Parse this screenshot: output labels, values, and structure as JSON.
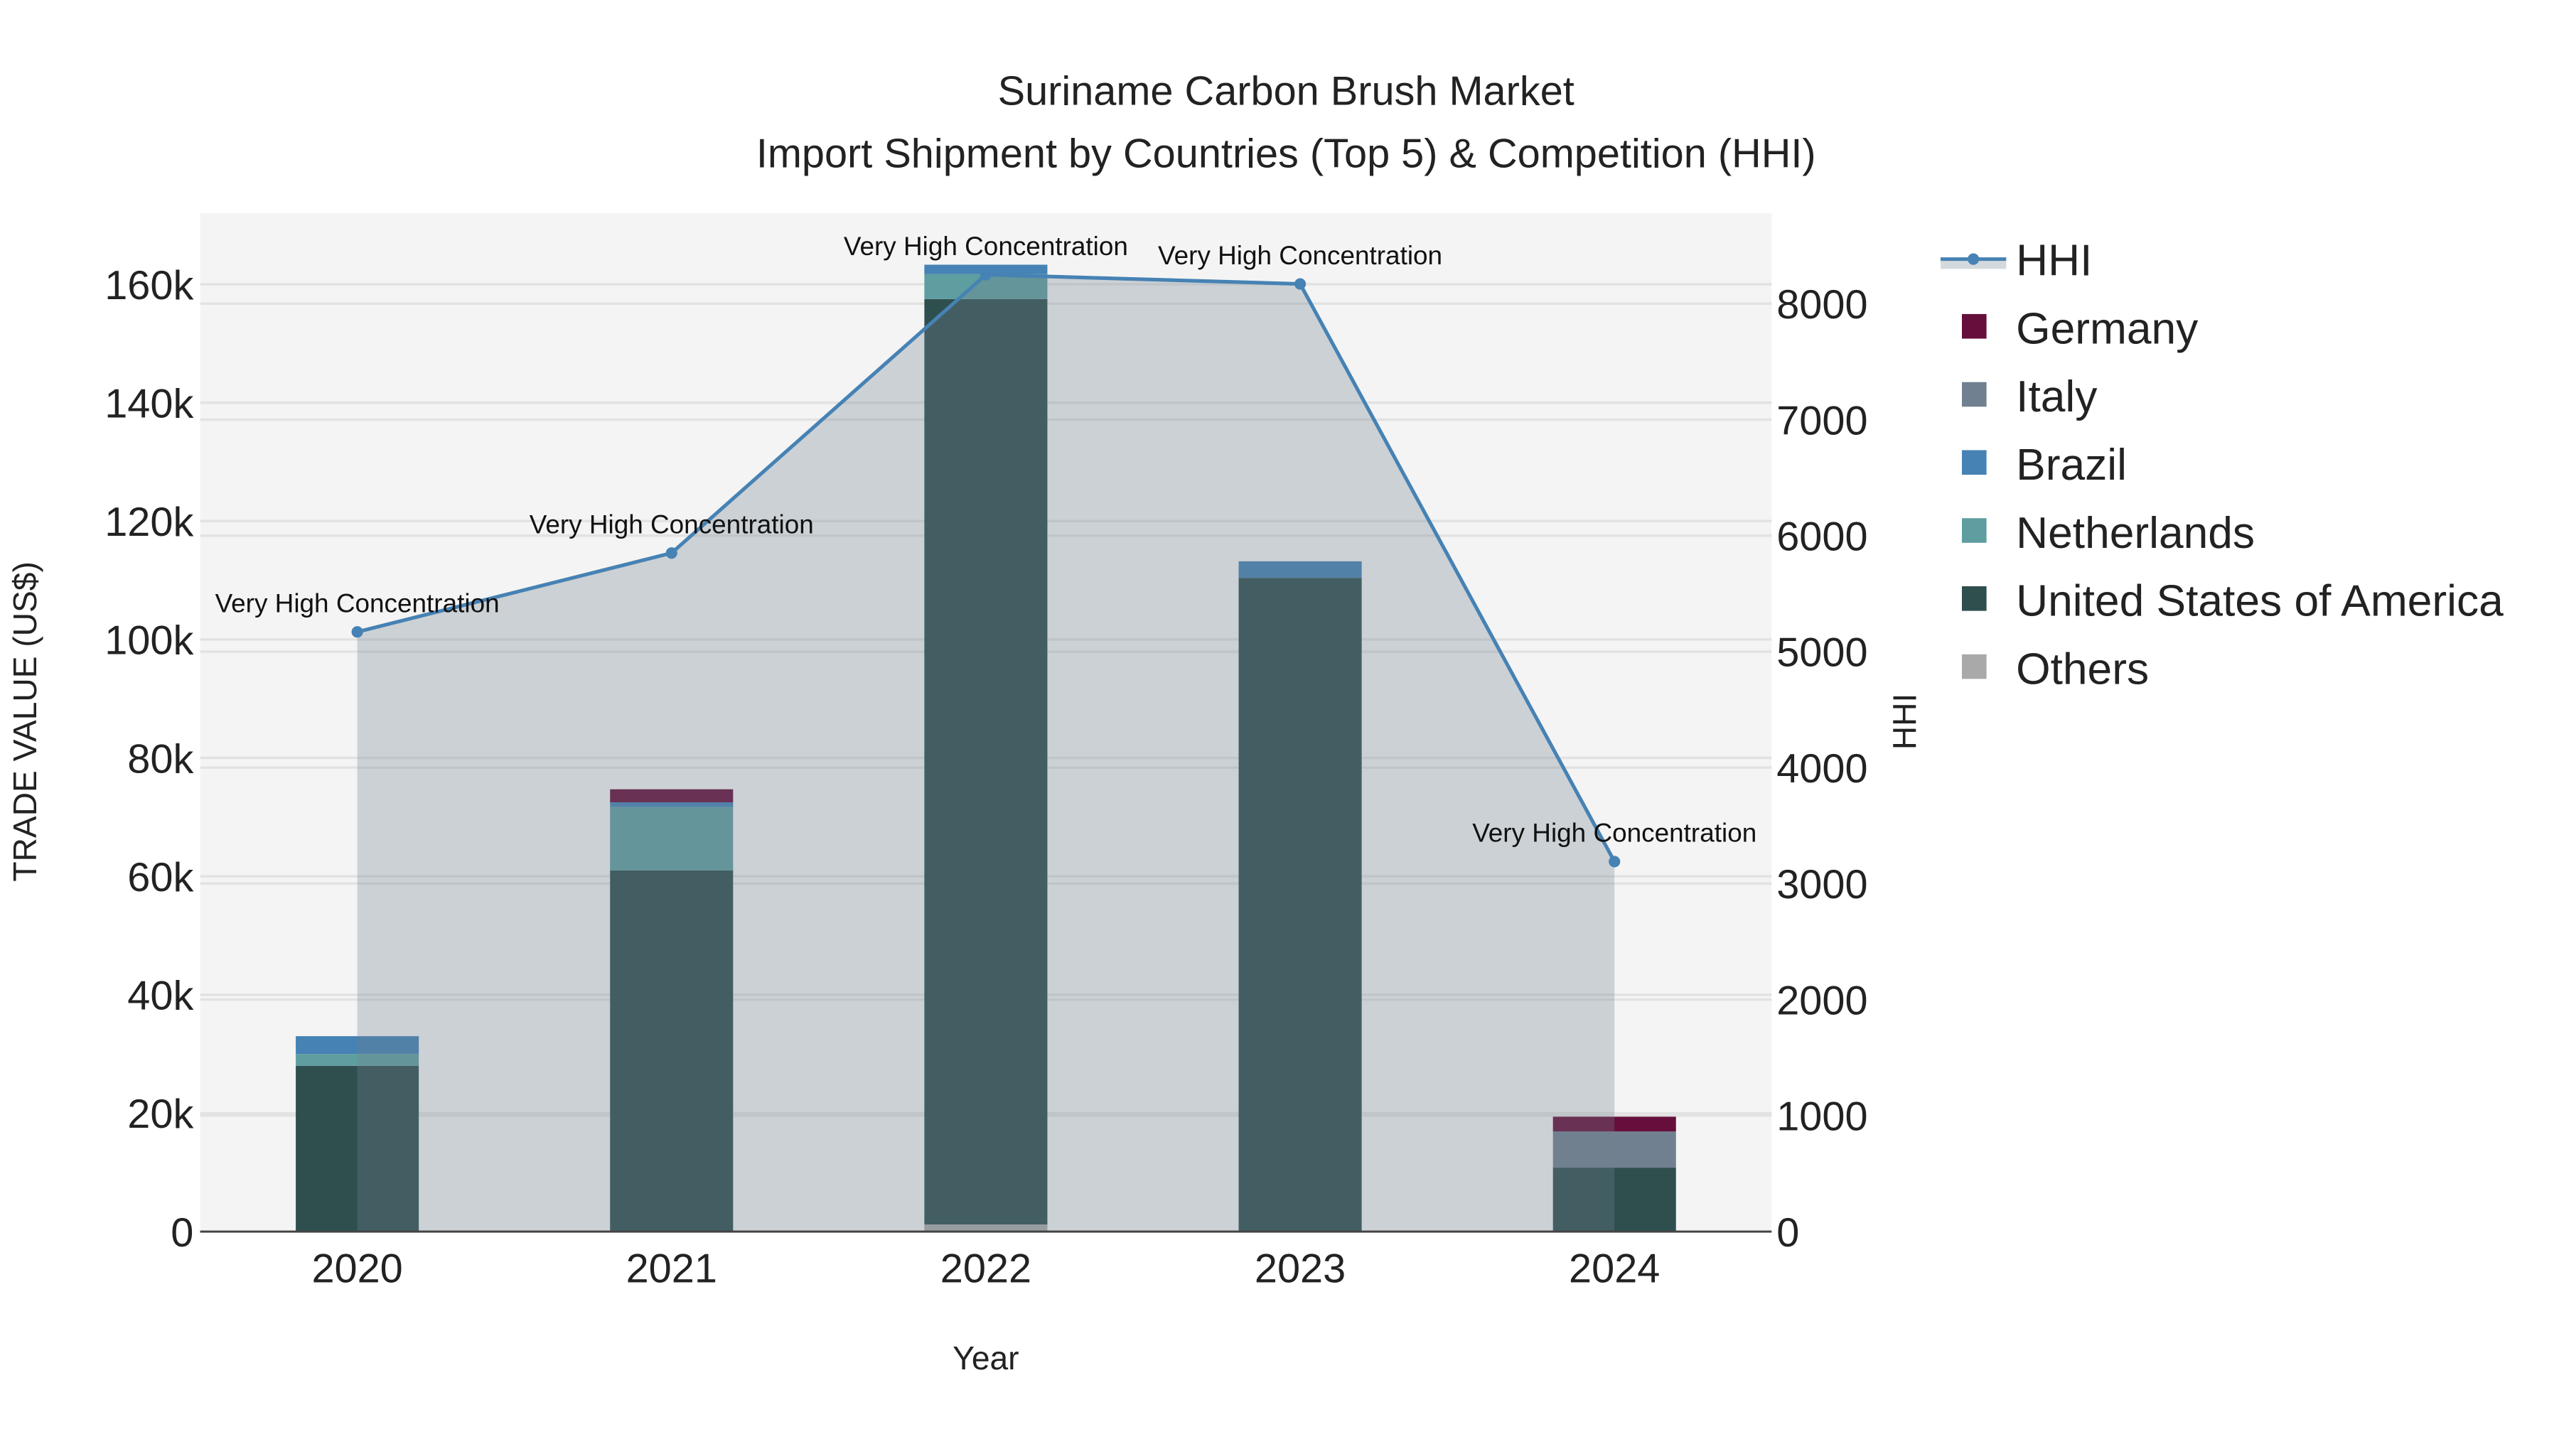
{
  "chart_data": {
    "type": "bar",
    "title": "Suriname Carbon Brush Market",
    "subtitle": "Import Shipment by Countries (Top 5) & Competition (HHI)",
    "xlabel": "Year",
    "ylabel": "TRADE VALUE (US$)",
    "y2label": "HHI",
    "categories": [
      "2020",
      "2021",
      "2022",
      "2023",
      "2024"
    ],
    "ylim": [
      0,
      172000
    ],
    "y2lim": [
      0,
      8780
    ],
    "yticks": [
      0,
      20000,
      40000,
      60000,
      80000,
      100000,
      120000,
      140000,
      160000
    ],
    "ytick_labels": [
      "0",
      "20k",
      "40k",
      "60k",
      "80k",
      "100k",
      "120k",
      "140k",
      "160k"
    ],
    "y2ticks": [
      0,
      1000,
      2000,
      3000,
      4000,
      5000,
      6000,
      7000,
      8000
    ],
    "y2tick_labels": [
      "0",
      "1000",
      "2000",
      "3000",
      "4000",
      "5000",
      "6000",
      "7000",
      "8000"
    ],
    "stacking": "stacked",
    "series": [
      {
        "name": "Others",
        "color": "#A9A9A9",
        "values": [
          0,
          0,
          1200,
          0,
          0
        ]
      },
      {
        "name": "United States of America",
        "color": "#2F4F4F",
        "values": [
          28000,
          61000,
          156300,
          110400,
          10800
        ]
      },
      {
        "name": "Netherlands",
        "color": "#5F9EA0",
        "values": [
          2000,
          10700,
          4200,
          0,
          0
        ]
      },
      {
        "name": "Brazil",
        "color": "#4682B4",
        "values": [
          3000,
          800,
          1600,
          2800,
          0
        ]
      },
      {
        "name": "Italy",
        "color": "#708090",
        "values": [
          0,
          0,
          0,
          0,
          6100
        ]
      },
      {
        "name": "Germany",
        "color": "#660F3C",
        "values": [
          0,
          2200,
          0,
          0,
          2500
        ]
      }
    ],
    "line": {
      "name": "HHI",
      "color": "#4682B4",
      "axis": "right",
      "values": [
        5170,
        5850,
        8250,
        8170,
        3190
      ],
      "annotations": [
        "Very High Concentration",
        "Very High Concentration",
        "Very High Concentration",
        "Very High Concentration",
        "Very High Concentration"
      ]
    },
    "legend": {
      "placement": "right",
      "entries": [
        "HHI",
        "Germany",
        "Italy",
        "Brazil",
        "Netherlands",
        "United States of America",
        "Others"
      ]
    },
    "grid": true
  }
}
